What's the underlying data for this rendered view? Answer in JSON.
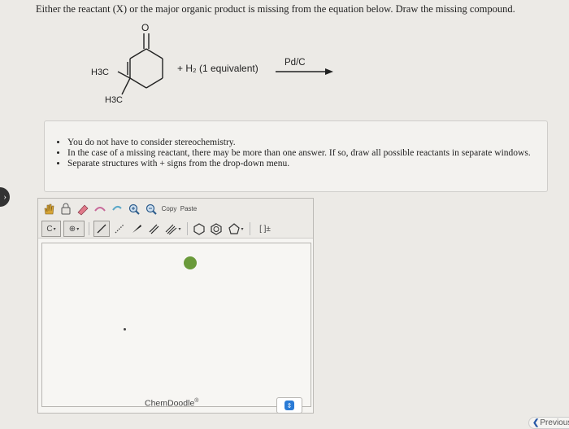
{
  "question": "Either the reactant (X) or the major organic product is missing from the equation below. Draw the missing compound.",
  "reaction": {
    "oxygen_label": "O",
    "methyl_label": "H3C",
    "plus_reagent": "+ H₂ (1 equivalent)",
    "catalyst": "Pd/C"
  },
  "notes": [
    "You do not have to consider stereochemistry.",
    "In the case of a missing reactant, there may be more than one answer. If so, draw all possible reactants in separate windows.",
    "Separate structures with + signs from the drop-down menu."
  ],
  "editor": {
    "copy_label": "Copy",
    "paste_label": "Paste",
    "element_label": "C",
    "charge_label": "⊕",
    "bracket_label": "[ ]±",
    "brand": "ChemDoodle",
    "brand_mark": "®"
  },
  "nav": {
    "previous_label": "Previous",
    "previous_arrow": "❮"
  },
  "colors": {
    "background": "#eceae6",
    "help_green": "#6a9a3a",
    "stepper_blue": "#2a7bd6"
  }
}
